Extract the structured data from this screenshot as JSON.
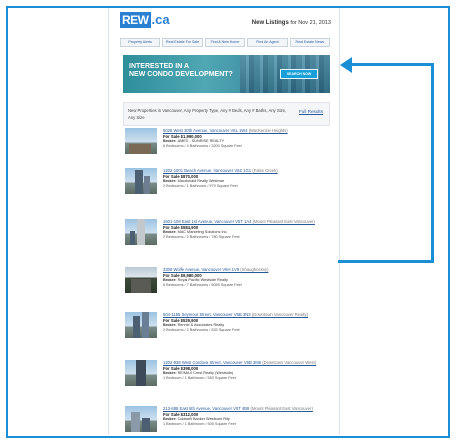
{
  "header": {
    "logo_main": "REW",
    "logo_suffix": ".ca",
    "date_bold": "New Listings",
    "date_text": " for Nov 21, 2013"
  },
  "nav": {
    "tabs": [
      "Property Alerts",
      "Real Estate For Sale",
      "Find A New Home",
      "Find An Agent",
      "Real Estate News"
    ]
  },
  "banner": {
    "headline_line1": "INTERESTED IN A",
    "headline_line2": "NEW CONDO DEVELOPMENT?",
    "cta": "SEARCH NOW"
  },
  "search": {
    "criteria": "New Properties in Vancouver, Any Property Type, Any # Beds, Any # Baths, Any Size, Any Size",
    "full_results": "Full Results"
  },
  "listings": [
    {
      "address": "5028 West 30th Avenue, Vancouver V6L 1W4",
      "area": "(MacKenzie Heights)",
      "price": "For Sale $1,990,000",
      "broker": "AMEX - SUNRISE REALTY",
      "details": "6 Bedrooms / 4 Bathrooms / 3200 Square Feet"
    },
    {
      "address": "1202-1001 Beach Avenue, Vancouver V6Z 1G1",
      "area": "(False Creek)",
      "price": "For Sale $870,000",
      "broker": "Macdonald Realty Westmar",
      "details": "2 Bedrooms / 1 Bathroom / 979 Square Feet"
    },
    {
      "address": "1601-108 East 1st Avenue, Vancouver V5T 1A4",
      "area": "(Mount Pleasant East Vancouver)",
      "price": "For Sale $584,900",
      "broker": "MAC Marketing Solutions Inc.",
      "details": "2 Bedrooms / 2 Bathrooms / 780 Square Feet"
    },
    {
      "address": "3309 Wolfe Avenue, Vancouver V6H 1V9",
      "area": "(Shaughnessy)",
      "price": "For Sale $9,980,000",
      "broker": "Royal Pacific Westside Realty",
      "details": "6 Bedrooms / 7 Bathrooms / 6059 Square Feet"
    },
    {
      "address": "504-1155 Seymour Street, Vancouver V6B 3N3",
      "area": "(Downtown Vancouver Realty)",
      "price": "For Sale $529,900",
      "broker": "Rennie & Associates Realty",
      "details": "2 Bedrooms / 2 Bathrooms / 833 Square Feet"
    },
    {
      "address": "1202-938 West Cordova Street, Vancouver V6B 3M6",
      "area": "(Downtown Vancouver West)",
      "price": "For Sale $398,000",
      "broker": "RE/MAX Crest Realty (Westside)",
      "details": "1 Bedroom / 1 Bathroom / 583 Square Feet"
    },
    {
      "address": "213-688 East 6th Avenue, Vancouver V5T 4B8",
      "area": "(Mount Pleasant East Vancouver)",
      "price": "For Sale $312,000",
      "broker": "Coldwell Banker Westburn Rity",
      "details": "1 Bedroom / 1 Bathroom / 505 Square Feet"
    }
  ],
  "labels": {
    "broker_prefix": "Broker: "
  },
  "colors": {
    "accent": "#1a8fd6",
    "link": "#2a5a9a",
    "banner": "#2e8f9b"
  }
}
